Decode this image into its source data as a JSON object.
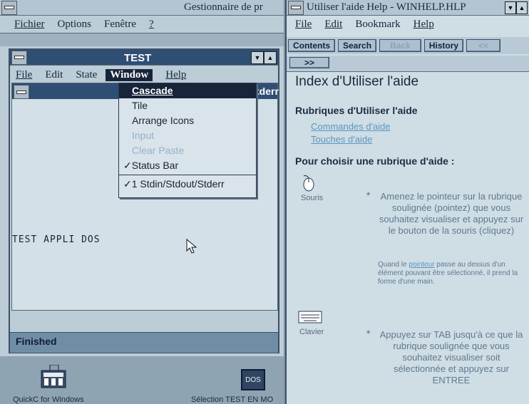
{
  "colors": {
    "title_active": "#2f4e73",
    "window_bg": "#bccdd8",
    "client_bg": "#d3e0e7",
    "link": "#5b96c1",
    "menu_highlight": "#17243a"
  },
  "program_manager": {
    "title": "Gestionnaire de pr",
    "menu": {
      "file": "Fichier",
      "options": "Options",
      "window": "Fenêtre",
      "help": "?"
    }
  },
  "test_window": {
    "title": "TEST",
    "menu": {
      "file": "File",
      "edit": "Edit",
      "state": "State",
      "window": "Window",
      "help": "Help"
    },
    "child_title_fragment": "tderr",
    "content_text": "TEST APPLI DOS",
    "status": "Finished"
  },
  "window_menu": {
    "items": [
      {
        "label": "Cascade",
        "state": "selected"
      },
      {
        "label": "Tile",
        "state": "normal"
      },
      {
        "label": "Arrange Icons",
        "state": "normal"
      },
      {
        "label": "Input",
        "state": "disabled"
      },
      {
        "label": "Clear Paste",
        "state": "disabled"
      },
      {
        "label": "Status Bar",
        "state": "checked"
      },
      {
        "label": "1 Stdin/Stdout/Stderr",
        "state": "checked"
      }
    ]
  },
  "desktop": {
    "icon1_label": "QuickC for Windows",
    "icon2_label": "Sélection TEST EN MO",
    "icon2_glyph": "DOS"
  },
  "help_window": {
    "title": "Utiliser l'aide Help - WINHELP.HLP",
    "menu": {
      "file": "File",
      "edit": "Edit",
      "bookmark": "Bookmark",
      "help": "Help"
    },
    "buttons": {
      "contents": "Contents",
      "search": "Search",
      "back": "Back",
      "history": "History",
      "prev": "<<",
      "next": ">>"
    },
    "heading": "Index d'Utiliser l'aide",
    "section": "Rubriques d'Utiliser l'aide",
    "links": [
      "Commandes d'aide",
      "Touches d'aide"
    ],
    "choose": "Pour choisir une rubrique d'aide :",
    "mouse_label": "Souris",
    "mouse_text": "Amenez le pointeur sur la rubrique soulignée (pointez) que vous souhaitez visualiser et appuyez sur le bouton de la souris (cliquez)",
    "mouse_note_pre": "Quand le ",
    "mouse_note_link": "pointeur",
    "mouse_note_post": " passe au dessus d'un élément pouvant être sélectionné, il prend la forme d'une main.",
    "kbd_label": "Clavier",
    "kbd_text": "Appuyez sur TAB jusqu'à ce que la rubrique soulignée que vous souhaitez visualiser soit sélectionnée et appuyez sur ENTREE",
    "bullet": "*"
  }
}
